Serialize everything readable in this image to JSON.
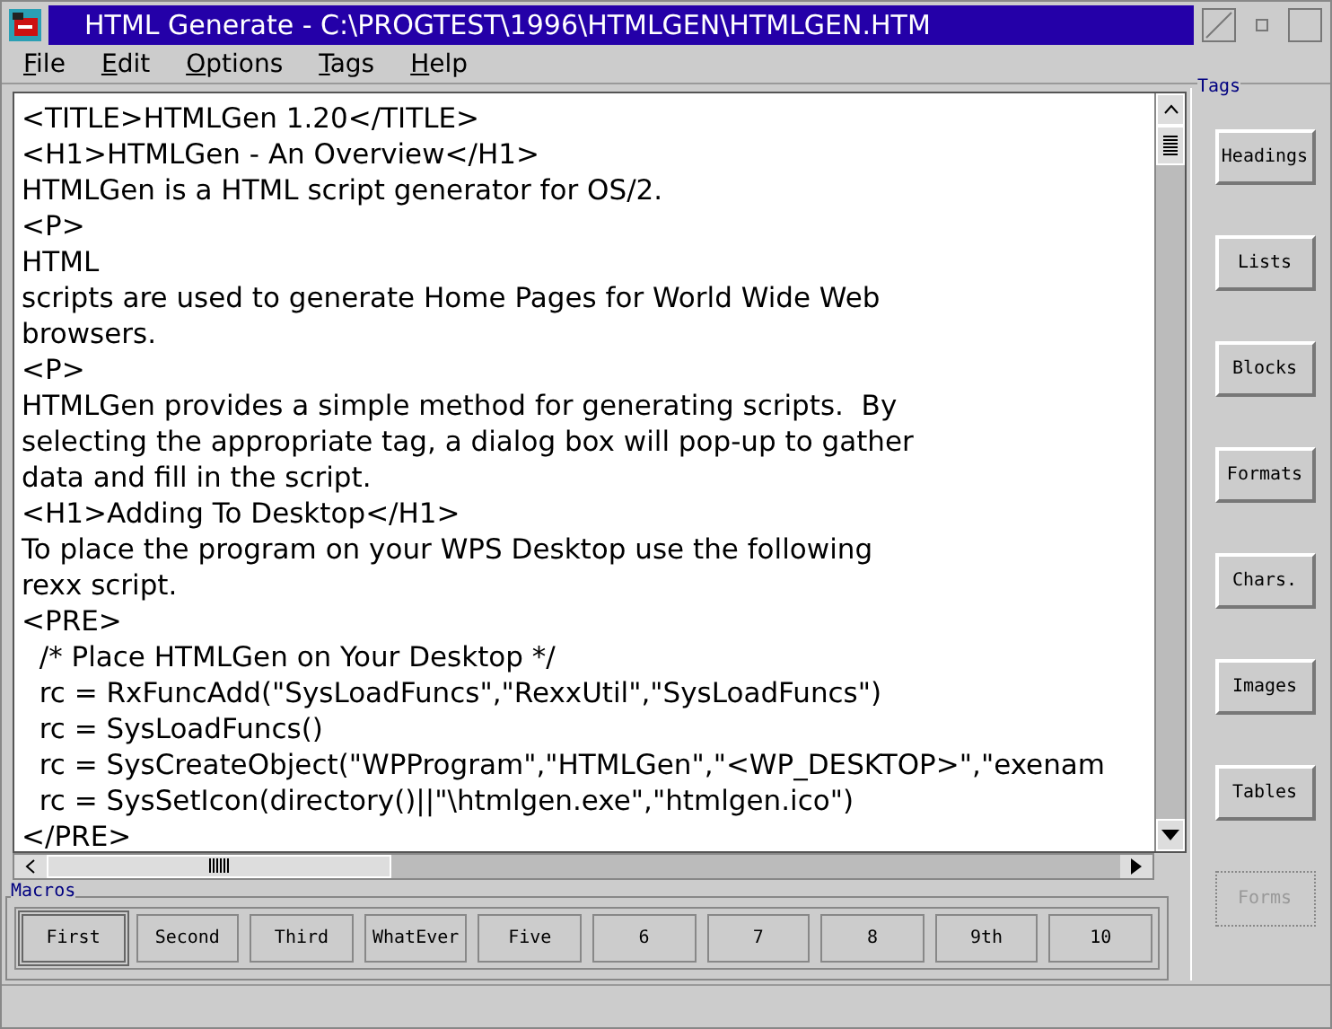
{
  "window": {
    "title": "HTML Generate - C:\\PROGTEST\\1996\\HTMLGEN\\HTMLGEN.HTM"
  },
  "menu": [
    "File",
    "Edit",
    "Options",
    "Tags",
    "Help"
  ],
  "editor": {
    "lines": [
      "<TITLE>HTMLGen 1.20</TITLE>",
      "<H1>HTMLGen - An Overview</H1>",
      "HTMLGen is a HTML script generator for OS/2.",
      "<P>",
      "HTML",
      "scripts are used to generate Home Pages for World Wide Web",
      "browsers.",
      "<P>",
      "HTMLGen provides a simple method for generating scripts.  By",
      "selecting the appropriate tag, a dialog box will pop-up to gather",
      "data and fill in the script.",
      "<H1>Adding To Desktop</H1>",
      "To place the program on your WPS Desktop use the following",
      "rexx script.",
      "<PRE>",
      "  /* Place HTMLGen on Your Desktop */",
      "  rc = RxFuncAdd(\"SysLoadFuncs\",\"RexxUtil\",\"SysLoadFuncs\")",
      "  rc = SysLoadFuncs()",
      "  rc = SysCreateObject(\"WPProgram\",\"HTMLGen\",\"<WP_DESKTOP>\",\"exenam",
      "  rc = SysSetIcon(directory()||\"\\htmlgen.exe\",\"htmlgen.ico\")",
      "</PRE>"
    ]
  },
  "tags": {
    "title": "Tags",
    "buttons": [
      {
        "label": "Headings",
        "disabled": false
      },
      {
        "label": "Lists",
        "disabled": false
      },
      {
        "label": "Blocks",
        "disabled": false
      },
      {
        "label": "Formats",
        "disabled": false
      },
      {
        "label": "Chars.",
        "disabled": false
      },
      {
        "label": "Images",
        "disabled": false
      },
      {
        "label": "Tables",
        "disabled": false
      },
      {
        "label": "Forms",
        "disabled": true
      }
    ]
  },
  "macros": {
    "title": "Macros",
    "buttons": [
      {
        "label": "First",
        "selected": true
      },
      {
        "label": "Second",
        "selected": false
      },
      {
        "label": "Third",
        "selected": false
      },
      {
        "label": "WhatEver",
        "selected": false
      },
      {
        "label": "Five",
        "selected": false
      },
      {
        "label": "6",
        "selected": false
      },
      {
        "label": "7",
        "selected": false
      },
      {
        "label": "8",
        "selected": false
      },
      {
        "label": "9th",
        "selected": false
      },
      {
        "label": "10",
        "selected": false
      }
    ]
  }
}
